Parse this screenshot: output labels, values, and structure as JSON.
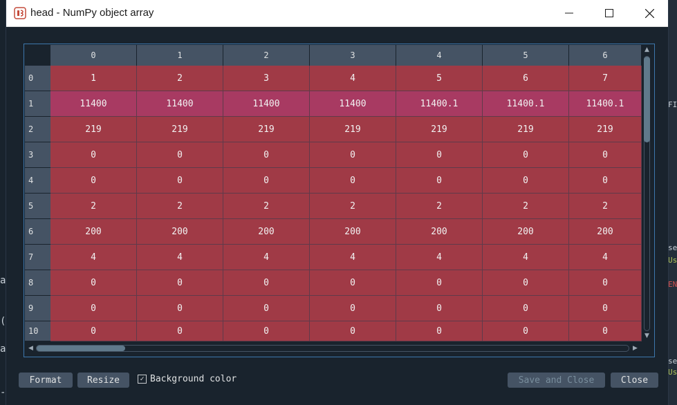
{
  "window": {
    "title": "head - NumPy object array",
    "controls": [
      "minimize",
      "maximize",
      "close"
    ]
  },
  "table": {
    "columns": [
      "0",
      "1",
      "2",
      "3",
      "4",
      "5",
      "6"
    ],
    "rows": [
      {
        "index": "0",
        "cells": [
          "1",
          "2",
          "3",
          "4",
          "5",
          "6",
          "7"
        ]
      },
      {
        "index": "1",
        "cells": [
          "11400",
          "11400",
          "11400",
          "11400",
          "11400.1",
          "11400.1",
          "11400.1"
        ]
      },
      {
        "index": "2",
        "cells": [
          "219",
          "219",
          "219",
          "219",
          "219",
          "219",
          "219"
        ]
      },
      {
        "index": "3",
        "cells": [
          "0",
          "0",
          "0",
          "0",
          "0",
          "0",
          "0"
        ]
      },
      {
        "index": "4",
        "cells": [
          "0",
          "0",
          "0",
          "0",
          "0",
          "0",
          "0"
        ]
      },
      {
        "index": "5",
        "cells": [
          "2",
          "2",
          "2",
          "2",
          "2",
          "2",
          "2"
        ]
      },
      {
        "index": "6",
        "cells": [
          "200",
          "200",
          "200",
          "200",
          "200",
          "200",
          "200"
        ]
      },
      {
        "index": "7",
        "cells": [
          "4",
          "4",
          "4",
          "4",
          "4",
          "4",
          "4"
        ]
      },
      {
        "index": "8",
        "cells": [
          "0",
          "0",
          "0",
          "0",
          "0",
          "0",
          "0"
        ]
      },
      {
        "index": "9",
        "cells": [
          "0",
          "0",
          "0",
          "0",
          "0",
          "0",
          "0"
        ]
      },
      {
        "index": "10",
        "cells": [
          "0",
          "0",
          "0",
          "0",
          "0",
          "0",
          "0"
        ]
      }
    ]
  },
  "buttons": {
    "format": "Format",
    "resize": "Resize",
    "background_color": "Background color",
    "background_color_checked": true,
    "save_and_close": "Save and Close",
    "close": "Close"
  },
  "colors": {
    "cell_default": "#a03a46",
    "cell_highlight": "#a83a62",
    "header_bg": "#455364",
    "window_bg": "#19232d",
    "accent": "#3d78ad"
  },
  "background_app": {
    "left_glyphs": [
      "a",
      "(",
      "a",
      "-"
    ],
    "right_glyphs": [
      "FI",
      "se",
      "Us",
      "EN",
      "se",
      "Us"
    ]
  }
}
